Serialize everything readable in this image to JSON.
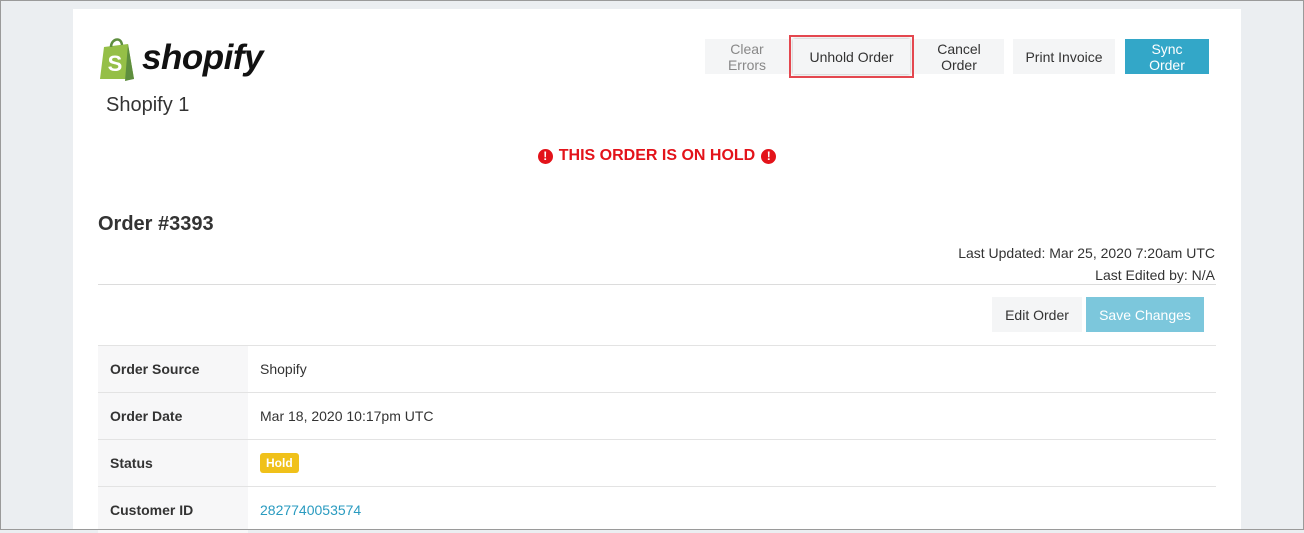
{
  "header": {
    "logo_text": "shopify",
    "store_name": "Shopify 1"
  },
  "top_actions": {
    "clear_errors": "Clear Errors",
    "unhold_order": "Unhold Order",
    "cancel_order": "Cancel Order",
    "print_invoice": "Print Invoice",
    "sync_order": "Sync Order"
  },
  "banner": {
    "text": "THIS ORDER IS ON HOLD",
    "icon": "exclamation-circle-icon",
    "color": "#e3131a"
  },
  "order": {
    "title": "Order #3393",
    "last_updated": "Last Updated: Mar 25, 2020 7:20am UTC",
    "last_edited": "Last Edited by: N/A"
  },
  "edit_actions": {
    "edit_order": "Edit Order",
    "save_changes": "Save Changes"
  },
  "details": [
    {
      "label": "Order Source",
      "value": "Shopify"
    },
    {
      "label": "Order Date",
      "value": "Mar 18, 2020 10:17pm UTC"
    },
    {
      "label": "Status",
      "value": "Hold"
    },
    {
      "label": "Customer ID",
      "value": "2827740053574"
    }
  ],
  "colors": {
    "accent": "#33a7c8",
    "hold_badge": "#f0c11a",
    "shopify_green": "#95bf47"
  }
}
